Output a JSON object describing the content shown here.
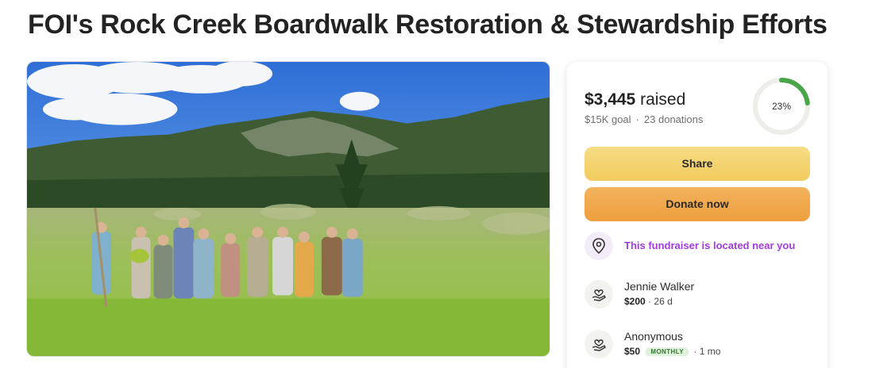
{
  "page": {
    "title": "FOI's Rock Creek Boardwalk Restoration & Stewardship Efforts"
  },
  "hero": {
    "image": "group-photo-mountain-meadow"
  },
  "summary": {
    "raised_amount": "$3,445",
    "raised_suffix": "raised",
    "goal": "$15K goal",
    "donations": "23 donations",
    "percent_label": "23%",
    "percent": 0.23,
    "ring_color": "#4aa548"
  },
  "actions": {
    "share_label": "Share",
    "donate_label": "Donate now"
  },
  "location": {
    "text": "This fundraiser is located near you",
    "icon": "map-pin-icon"
  },
  "donors": [
    {
      "name": "Jennie Walker",
      "amount": "$200",
      "badge": "",
      "time": "26 d",
      "icon": "heart-hand-icon"
    },
    {
      "name": "Anonymous",
      "amount": "$50",
      "badge": "MONTHLY",
      "time": "1 mo",
      "icon": "heart-hand-icon"
    }
  ]
}
